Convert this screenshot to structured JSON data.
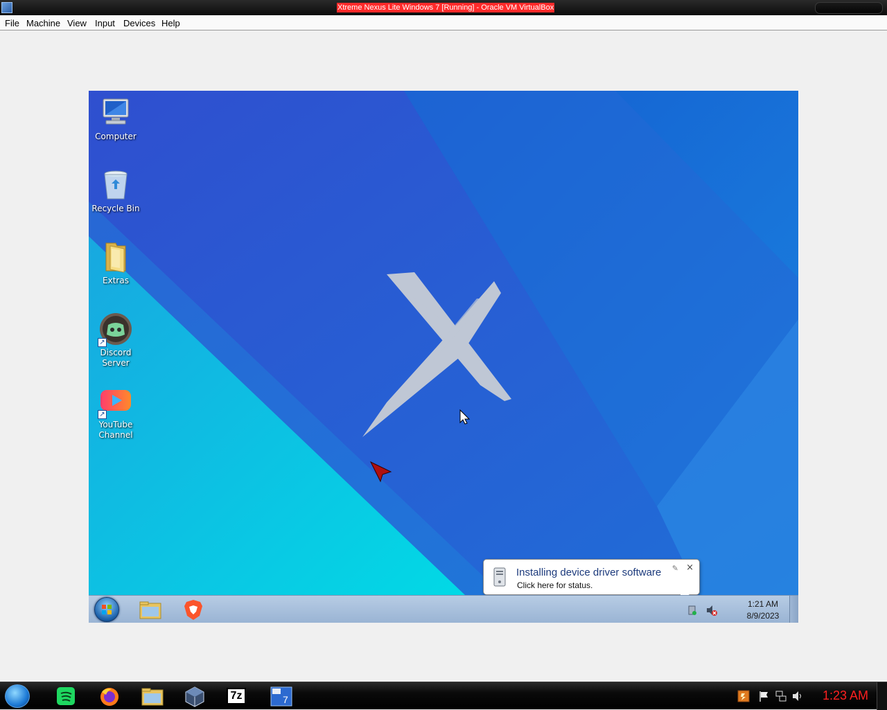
{
  "window": {
    "title": "Xtreme Nexus Lite Windows 7 [Running] - Oracle VM VirtualBox"
  },
  "menu": {
    "items": [
      {
        "label": "File"
      },
      {
        "label": "Machine"
      },
      {
        "label": "View"
      },
      {
        "label": "Input"
      },
      {
        "label": "Devices"
      },
      {
        "label": "Help"
      }
    ]
  },
  "guest": {
    "desktop_icons": [
      {
        "label": "Computer",
        "icon": "computer-icon"
      },
      {
        "label": "Recycle Bin",
        "icon": "recycle-bin-icon"
      },
      {
        "label": "Extras",
        "icon": "folder-icon"
      },
      {
        "label": "Discord Server",
        "icon": "discord-icon",
        "shortcut": true
      },
      {
        "label": "YouTube Channel",
        "icon": "youtube-icon",
        "shortcut": true
      }
    ],
    "taskbar": {
      "pinned": [
        "file-explorer-icon",
        "brave-browser-icon"
      ],
      "tray_icons": [
        "device-install-icon",
        "volume-muted-icon"
      ],
      "clock_time": "1:21 AM",
      "clock_date": "8/9/2023"
    },
    "notification": {
      "title": "Installing device driver software",
      "text": "Click here for status.",
      "close_glyph": "×"
    },
    "colors": {
      "wallpaper_light": "#00d4e4",
      "wallpaper_mid": "#1e78dc",
      "wallpaper_dark": "#2b56d0",
      "logo_x": "#c8cdd6"
    }
  },
  "host_taskbar": {
    "apps": [
      "spotify-icon",
      "firefox-icon",
      "file-explorer-icon",
      "virtualbox-icon",
      "7zip-icon",
      "win7-usb-tool-icon"
    ],
    "seven_zip_label": "7z",
    "clock": "1:23 AM",
    "clock_color": "#ff2020"
  }
}
